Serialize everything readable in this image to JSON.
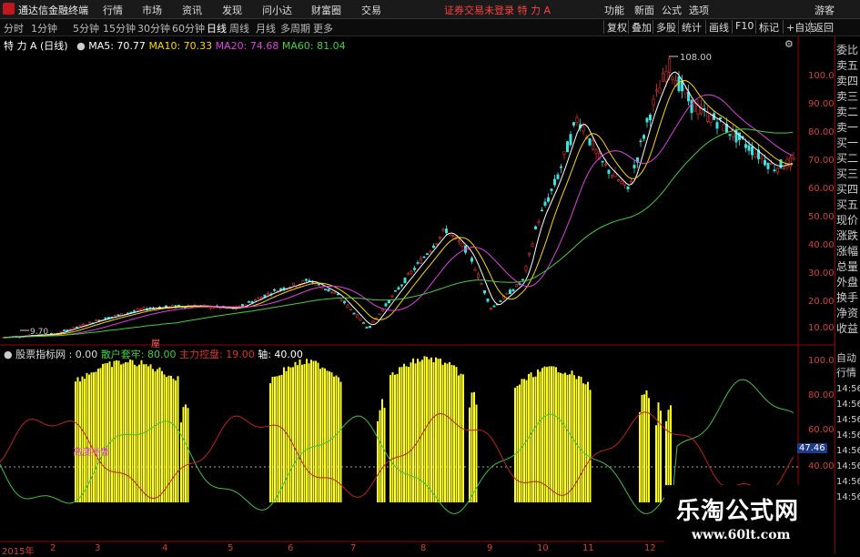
{
  "titlebar": {
    "app_name": "通达信金融终端",
    "menus": [
      "行情",
      "市场",
      "资讯",
      "发现",
      "问小达",
      "财富圈",
      "交易"
    ],
    "notice": "证券交易未登录  特 力 A",
    "right_menus": [
      "功能",
      "新面",
      "公式",
      "选项"
    ],
    "user": "游客"
  },
  "periodbar": {
    "periods": [
      "分时",
      "1分钟",
      "5分钟",
      "15分钟",
      "30分钟",
      "60分钟",
      "日线",
      "周线",
      "月线",
      "多周期",
      "更多"
    ],
    "selected": "日线",
    "tools": [
      "复权",
      "叠加",
      "多股",
      "统计",
      "画线",
      "F10",
      "标记",
      "+自选",
      "返回"
    ]
  },
  "main_chart": {
    "label": "特 力 A (日线)",
    "ma_labels": [
      {
        "text": "MA5: 70.77",
        "color": "#ffffff"
      },
      {
        "text": "MA10: 70.33",
        "color": "#ffd700"
      },
      {
        "text": "MA20: 74.68",
        "color": "#e040e0"
      },
      {
        "text": "MA60: 81.04",
        "color": "#40d040"
      }
    ],
    "y_ticks": [
      "100.0",
      "90.00",
      "80.00",
      "70.00",
      "60.00",
      "50.00",
      "40.00",
      "30.00",
      "20.00",
      "10.00"
    ],
    "high_label": "108.00",
    "low_label": "9.70",
    "marker": "屋"
  },
  "indicator": {
    "name": "股票指标网 : 0.00",
    "labels": [
      {
        "text": "散户套牢: 80.00",
        "color": "#40d040"
      },
      {
        "text": "主力控盘: 19.00",
        "color": "#e03030"
      },
      {
        "text": "轴: 40.00",
        "color": "#ffffff"
      }
    ],
    "annotation": "高度控盘",
    "y_ticks": [
      "100.0",
      "80.00",
      "60.00",
      "40.00"
    ],
    "value_badge": "47.46"
  },
  "x_axis": {
    "labels": [
      "2015年",
      "2",
      "3",
      "4",
      "5",
      "6",
      "7",
      "8",
      "9",
      "10",
      "11",
      "12"
    ]
  },
  "right_panel": {
    "top_items": [
      "委比",
      "卖五",
      "卖四",
      "卖三",
      "卖二",
      "卖一",
      "买一",
      "买二",
      "买三",
      "买四",
      "买五",
      "现价",
      "涨跌",
      "涨幅",
      "总量",
      "外盘",
      "换手",
      "净资",
      "收益"
    ],
    "bottom_items": [
      "自动",
      "行情",
      "14:56",
      "14:56",
      "14:56",
      "14:56",
      "14:56",
      "14:56",
      "14:56",
      "14:56"
    ]
  },
  "watermark": {
    "line1": "乐淘公式网",
    "line2": "www.60lt.com"
  }
}
